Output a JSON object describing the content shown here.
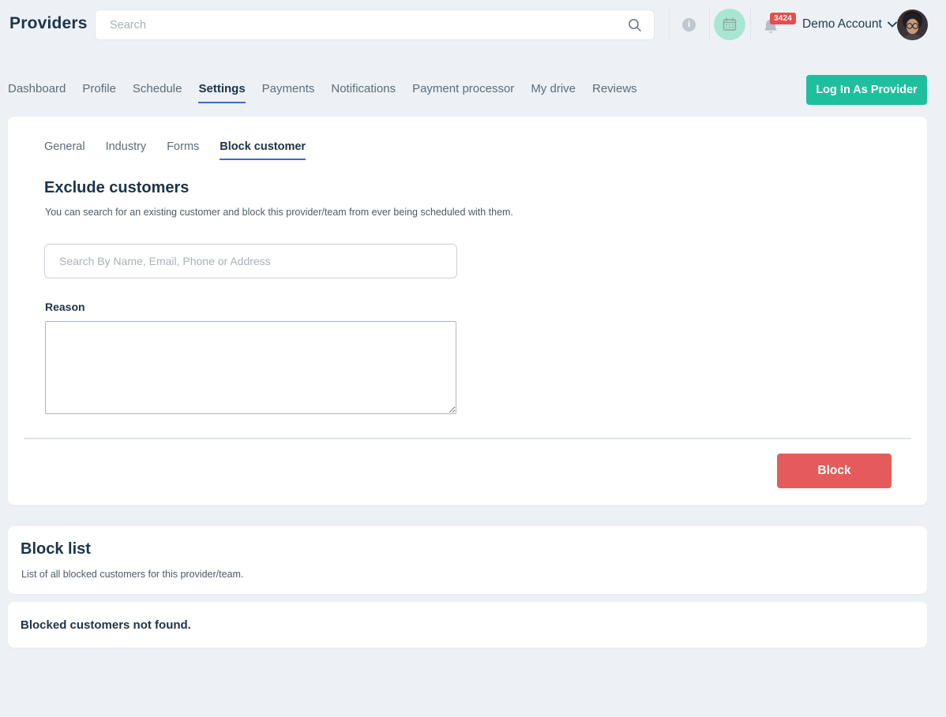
{
  "header": {
    "title": "Providers",
    "search": {
      "placeholder": "Search"
    },
    "notifications": {
      "badge": "3424"
    },
    "account": {
      "label": "Demo Account"
    }
  },
  "nav": {
    "tabs": [
      {
        "label": "Dashboard",
        "active": false
      },
      {
        "label": "Profile",
        "active": false
      },
      {
        "label": "Schedule",
        "active": false
      },
      {
        "label": "Settings",
        "active": true
      },
      {
        "label": "Payments",
        "active": false
      },
      {
        "label": "Notifications",
        "active": false
      },
      {
        "label": "Payment processor",
        "active": false
      },
      {
        "label": "My drive",
        "active": false
      },
      {
        "label": "Reviews",
        "active": false
      }
    ],
    "login_button": "Log In As Provider"
  },
  "settings": {
    "tabs": [
      {
        "label": "General",
        "active": false
      },
      {
        "label": "Industry",
        "active": false
      },
      {
        "label": "Forms",
        "active": false
      },
      {
        "label": "Block customer",
        "active": true
      }
    ],
    "exclude": {
      "heading": "Exclude customers",
      "description": "You can search for an existing customer and block this provider/team from ever being scheduled with them.",
      "search_placeholder": "Search By Name, Email, Phone or Address",
      "reason_label": "Reason",
      "reason_value": "",
      "block_button": "Block"
    }
  },
  "block_list": {
    "heading": "Block list",
    "description": "List of all blocked customers for this provider/team.",
    "empty_message": "Blocked customers not found."
  },
  "icons": {
    "search": "magnifying-glass",
    "info": "i-in-circle",
    "calendar": "calendar-grid",
    "bell": "notification-bell",
    "chevron_down": "chevron-down",
    "avatar": "user-photo"
  },
  "colors": {
    "page_background": "#edf1f6",
    "card_background": "#ffffff",
    "accent_green": "#1fbf9e",
    "danger_red": "#e55b5b",
    "badge_red": "#e84c4b",
    "tab_underline_blue": "#3d6ad0",
    "heading_navy": "#1b3348",
    "inactive_tab_gray": "#5d6b78",
    "mint_icon_bg": "#a9e6d2"
  }
}
